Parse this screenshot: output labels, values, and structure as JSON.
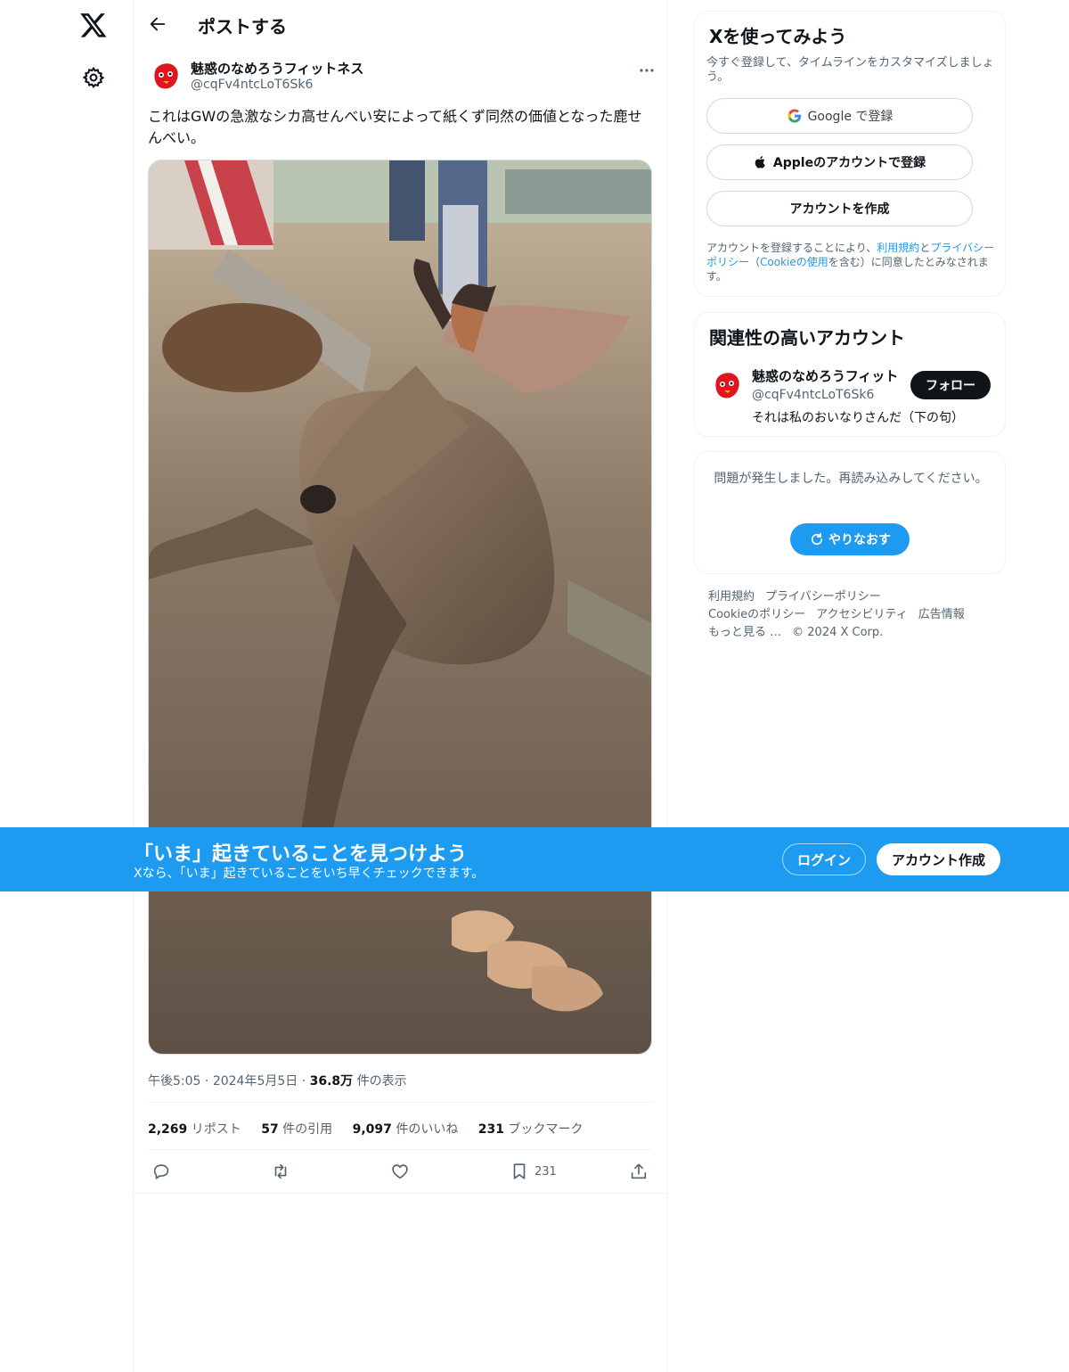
{
  "topbar": {
    "title": "ポストする"
  },
  "post": {
    "author_name": "魅惑のなめろうフィットネス",
    "author_handle": "@cqFv4ntcLoT6Sk6",
    "text": "これはGWの急激なシカ高せんべい安によって紙くず同然の価値となった鹿せんべい。",
    "time": "午後5:05",
    "date": "2024年5月5日",
    "views_count": "36.8万",
    "views_label": "件の表示",
    "stats": {
      "reposts_count": "2,269",
      "reposts_label": "リポスト",
      "quotes_count": "57",
      "quotes_label": "件の引用",
      "likes_count": "9,097",
      "likes_label": "件のいいね",
      "bookmarks_count": "231",
      "bookmarks_label": "ブックマーク"
    },
    "bookmark_action_count": "231"
  },
  "signup_card": {
    "title": "Xを使ってみよう",
    "subtitle": "今すぐ登録して、タイムラインをカスタマイズしましょう。",
    "google_label": "Google で登録",
    "apple_label": "Appleのアカウントで登録",
    "create_label": "アカウントを作成",
    "legal_prefix": "アカウントを登録することにより、",
    "legal_terms": "利用規約",
    "legal_and": "と",
    "legal_privacy": "プライバシーポリシー",
    "legal_open": "（",
    "legal_cookie": "Cookieの使用",
    "legal_suffix": "を含む）に同意したとみなされます。"
  },
  "relevant_card": {
    "title": "関連性の高いアカウント",
    "name": "魅惑のなめろうフィット",
    "handle": "@cqFv4ntcLoT6Sk6",
    "bio": "それは私のおいなりさんだ（下の句）",
    "follow_label": "フォロー"
  },
  "error_card": {
    "message": "問題が発生しました。再読み込みしてください。",
    "retry_label": "やりなおす"
  },
  "footer": {
    "links": [
      "利用規約",
      "プライバシーポリシー",
      "Cookieのポリシー",
      "アクセシビリティ",
      "広告情報",
      "もっと見る …",
      "© 2024 X Corp."
    ]
  },
  "banner": {
    "title": "「いま」起きていることを見つけよう",
    "subtitle": "Xなら、「いま」起きていることをいち早くチェックできます。",
    "login_label": "ログイン",
    "signup_label": "アカウント作成"
  },
  "colors": {
    "accent": "#1d9bf0",
    "text": "#0f1419",
    "secondary": "#536471",
    "avatar": "#e0151f"
  },
  "icons": [
    "x-logo-icon",
    "gear-icon",
    "back-arrow-icon",
    "more-icon",
    "google-icon",
    "apple-icon",
    "reply-icon",
    "repost-icon",
    "like-icon",
    "bookmark-icon",
    "share-icon",
    "refresh-icon"
  ]
}
